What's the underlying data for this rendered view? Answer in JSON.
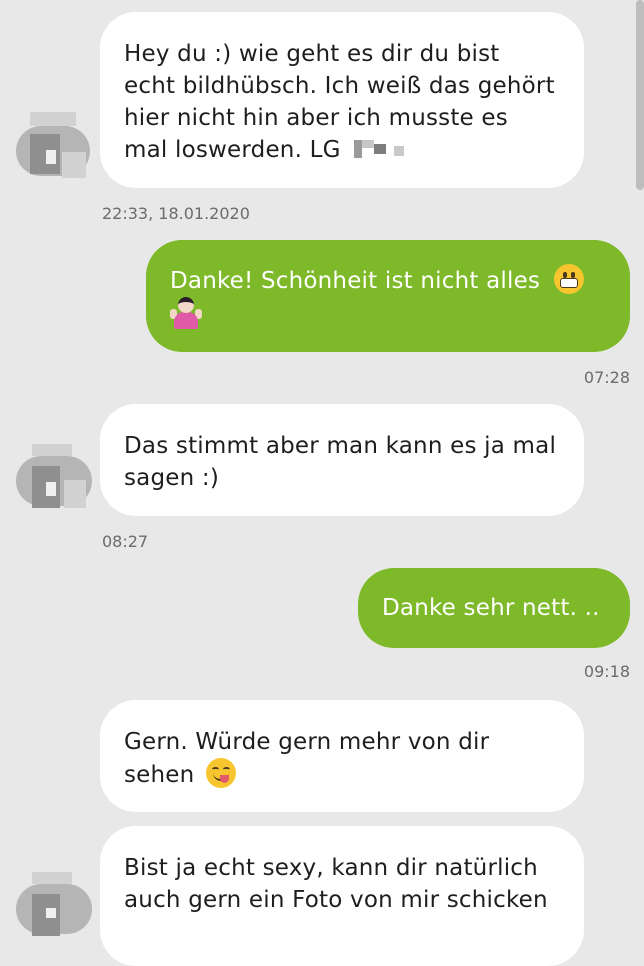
{
  "messages": [
    {
      "direction": "incoming",
      "text": "Hey du :) wie geht es dir du bist echt bildhübsch. Ich weiß das gehört hier nicht hin aber ich musste es mal loswerden. LG",
      "timestamp": "22:33, 18.01.2020"
    },
    {
      "direction": "outgoing",
      "text": "Danke! Schönheit ist nicht alles",
      "emojis": [
        "grimacing-face-emoji",
        "woman-shrugging-emoji"
      ],
      "timestamp": "07:28"
    },
    {
      "direction": "incoming",
      "text": "Das stimmt aber man kann es ja mal sagen :)",
      "timestamp": "08:27"
    },
    {
      "direction": "outgoing",
      "text": "Danke sehr nett. ..",
      "timestamp": "09:18"
    },
    {
      "direction": "incoming",
      "text": "Gern. Würde gern mehr von dir sehen",
      "emojis": [
        "face-savoring-food-emoji"
      ]
    },
    {
      "direction": "incoming",
      "text": "Bist ja echt sexy, kann dir natürlich auch gern ein Foto von mir schicken"
    }
  ],
  "colors": {
    "background": "#e8e8e8",
    "incoming_bubble": "#ffffff",
    "outgoing_bubble": "#7db928",
    "timestamp_text": "#6b6b6b"
  }
}
